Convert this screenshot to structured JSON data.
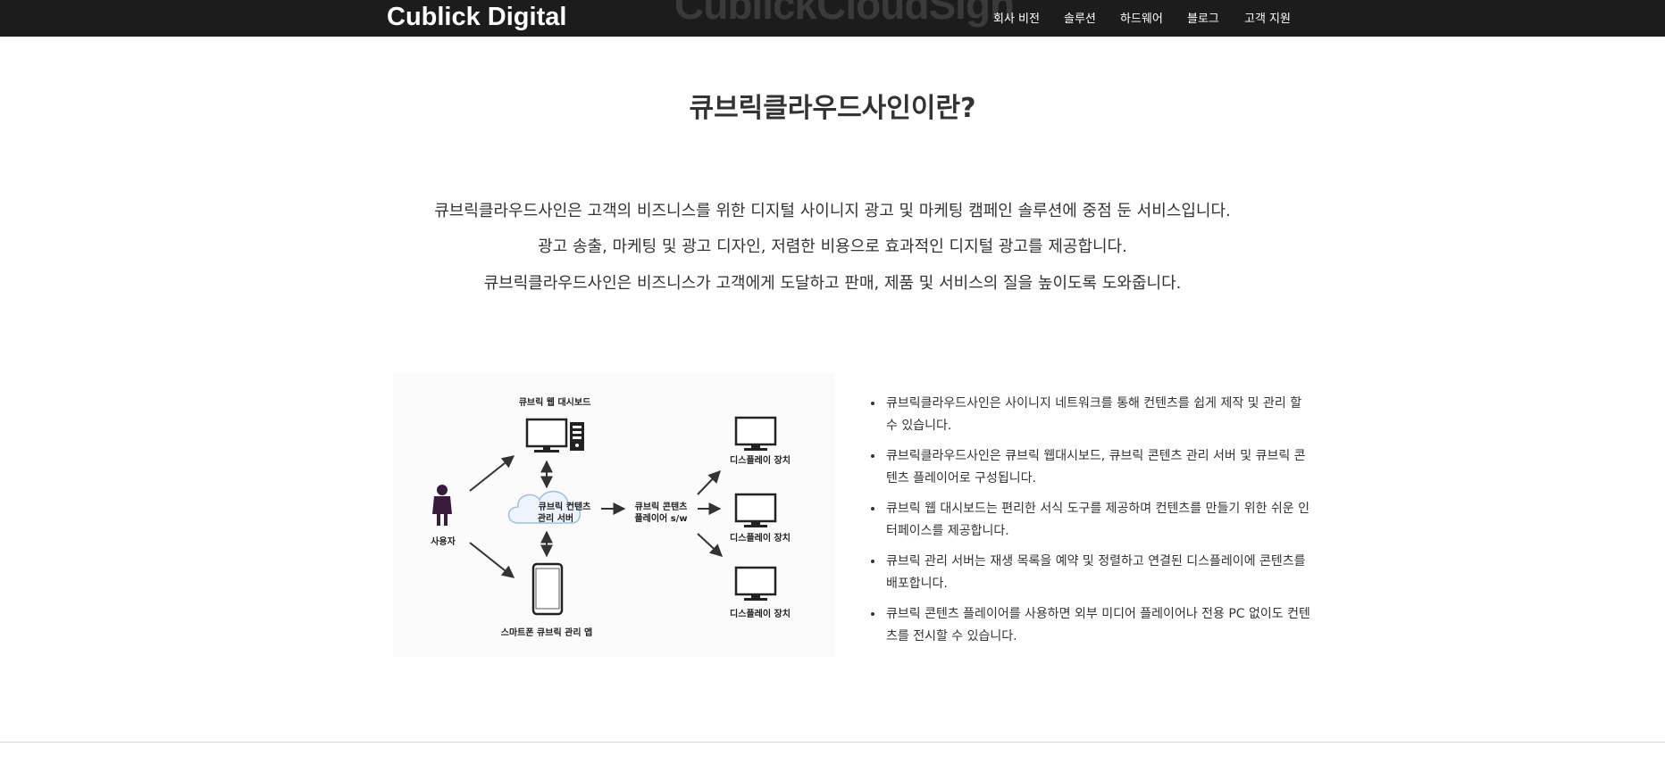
{
  "header": {
    "brand": "Cublick Digital",
    "ghost_text": "CublickCloudSign",
    "nav": [
      {
        "label": "회사 비전"
      },
      {
        "label": "솔루션"
      },
      {
        "label": "하드웨어"
      },
      {
        "label": "블로그"
      },
      {
        "label": "고객 지원"
      }
    ]
  },
  "main": {
    "title": "큐브릭클라우드사인이란?",
    "intro": [
      "큐브릭클라우드사인은 고객의 비즈니스를 위한 디지털 사이니지 광고 및 마케팅 캠페인 솔루션에 중점 둔 서비스입니다.",
      "광고 송출, 마케팅 및 광고 디자인, 저렴한 비용으로 효과적인 디지털 광고를 제공합니다.",
      "큐브릭클라우드사인은 비즈니스가 고객에게 도달하고 판매, 제품 및 서비스의 질을 높이도록 도와줍니다."
    ],
    "bullets": [
      "큐브릭클라우드사인은 사이니지 네트워크를 통해 컨텐츠를 쉽게 제작 및 관리 할 수 있습니다.",
      "큐브릭클라우드사인은 큐브릭 웹대시보드, 큐브릭 콘텐츠 관리 서버 및 큐브릭 콘텐츠 플레이어로 구성됩니다.",
      "큐브릭 웹 대시보드는 편리한 서식 도구를 제공하며 컨텐츠를 만들기 위한 쉬운 인터페이스를 제공합니다.",
      "큐브릭 관리 서버는 재생 목록을 예약 및 정렬하고 연결된 디스플레이에 콘텐츠를 배포합니다.",
      "큐브릭 콘텐츠 플레이어를 사용하면 외부 미디어 플레이어나 전용 PC 없이도 컨텐츠를 전시할 수 있습니다."
    ]
  },
  "diagram": {
    "web_dashboard": "큐브릭 웹 대시보드",
    "user": "사용자",
    "server_line1": "큐브릭 컨텐츠",
    "server_line2": "관리 서버",
    "player_line1": "큐브릭 콘텐츠",
    "player_line2": "플레이어 s/w",
    "display1": "디스플레이 장치",
    "display2": "디스플레이 장치",
    "display3": "디스플레이 장치",
    "mobile_app": "스마트폰 큐브릭 관리 앱"
  }
}
